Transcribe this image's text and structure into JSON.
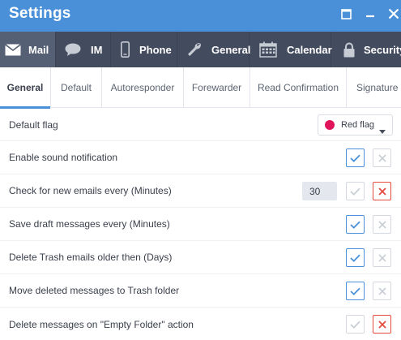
{
  "window": {
    "title": "Settings",
    "accent": "#4a90d9"
  },
  "main_tabs": [
    {
      "label": "Mail",
      "icon": "envelope-icon",
      "active": true
    },
    {
      "label": "IM",
      "icon": "chat-bubble-icon",
      "active": false
    },
    {
      "label": "Phone",
      "icon": "phone-icon",
      "active": false
    },
    {
      "label": "General",
      "icon": "wrench-icon",
      "active": false
    },
    {
      "label": "Calendar",
      "icon": "calendar-icon",
      "active": false
    },
    {
      "label": "Security",
      "icon": "lock-icon",
      "active": false
    }
  ],
  "sub_tabs": [
    {
      "label": "General",
      "active": true
    },
    {
      "label": "Default",
      "active": false
    },
    {
      "label": "Autoresponder",
      "active": false
    },
    {
      "label": "Forewarder",
      "active": false
    },
    {
      "label": "Read Confirmation",
      "active": false
    },
    {
      "label": "Signature",
      "active": false
    }
  ],
  "settings": {
    "default_flag": {
      "label": "Default flag",
      "value": "Red flag",
      "flag_color": "#e0135b"
    },
    "rows": [
      {
        "label": "Enable sound notification",
        "enabled": true
      },
      {
        "label": "Check for new emails every (Minutes)",
        "value": "30",
        "enabled": false
      },
      {
        "label": "Save draft messages every (Minutes)",
        "enabled": true
      },
      {
        "label": "Delete Trash emails older then (Days)",
        "enabled": true
      },
      {
        "label": "Move deleted messages to Trash folder",
        "enabled": true
      },
      {
        "label": "Delete messages on \"Empty Folder\" action",
        "enabled": false
      }
    ]
  },
  "colors": {
    "title_bar": "#4a90d9",
    "tab_bar": "#434b5e",
    "tab_active": "#566074",
    "check_on": "#4a90d9",
    "cross_on": "#e34b3c",
    "inactive": "#c9ced6"
  }
}
